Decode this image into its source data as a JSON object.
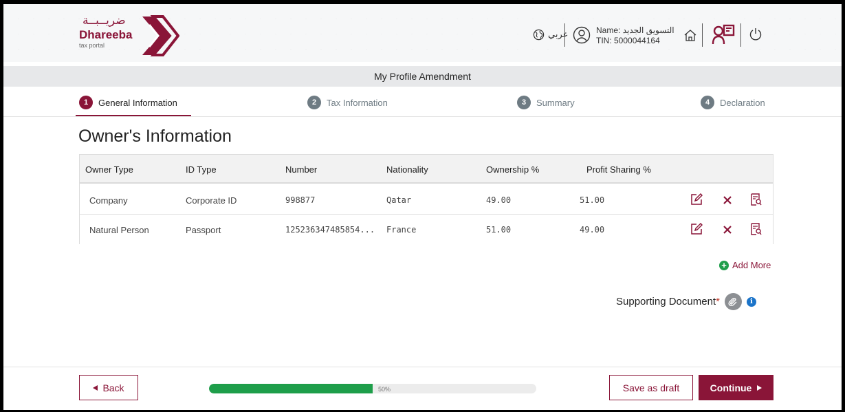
{
  "header": {
    "logo_arabic": "ضريــبــة",
    "logo_name": "Dhareeba",
    "logo_sub": "tax portal",
    "language_label": "عربي",
    "user_name": "Name: التسويق الجديد",
    "user_tin": "TIN: 5000044164"
  },
  "page_title": "My Profile Amendment",
  "steps": [
    {
      "num": "1",
      "label": "General Information"
    },
    {
      "num": "2",
      "label": "Tax Information"
    },
    {
      "num": "3",
      "label": "Summary"
    },
    {
      "num": "4",
      "label": "Declaration"
    }
  ],
  "section_title": "Owner's Information",
  "table": {
    "headers": [
      "Owner Type",
      "ID Type",
      "Number",
      "Nationality",
      "Ownership %",
      "Profit Sharing %"
    ],
    "rows": [
      [
        "Company",
        "Corporate ID",
        "998877",
        "Qatar",
        "49.00",
        "51.00"
      ],
      [
        "Natural Person",
        "Passport",
        "125236347485854...",
        "France",
        "51.00",
        "49.00"
      ]
    ]
  },
  "add_more_label": "Add More",
  "supporting_document_label": "Supporting Document",
  "required_mark": "*",
  "footer": {
    "back_label": "Back",
    "progress_percent": 50,
    "progress_text": "50%",
    "save_draft_label": "Save as draft",
    "continue_label": "Continue"
  },
  "colors": {
    "brand": "#8a1538",
    "progress": "#1e9e4a",
    "step_inactive": "#6e7b83",
    "info": "#1b74c9"
  },
  "icons": [
    "globe-icon",
    "user-icon",
    "home-icon",
    "profile-switch-icon",
    "power-icon",
    "edit-icon",
    "delete-icon",
    "view-document-icon",
    "plus-circle-icon",
    "paperclip-icon",
    "info-icon",
    "caret-left-icon",
    "caret-right-icon"
  ]
}
